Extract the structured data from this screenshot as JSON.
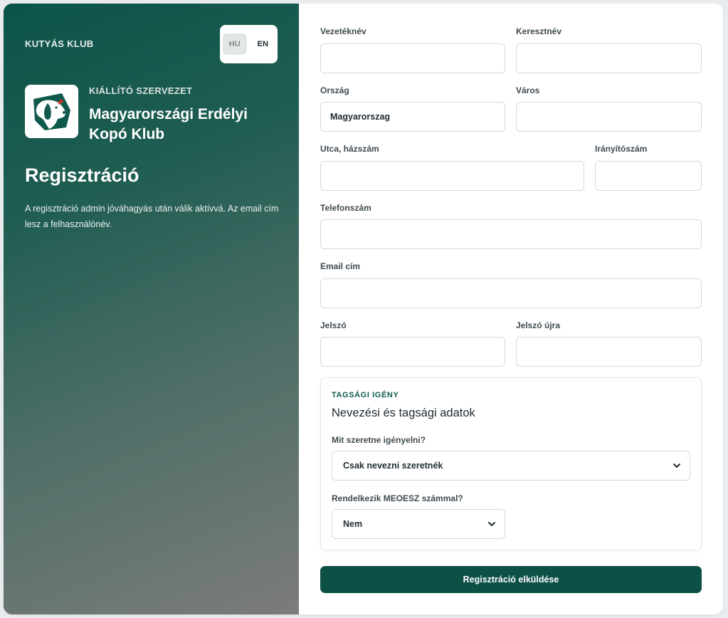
{
  "brand": "KUTYÁS KLUB",
  "language": {
    "hu": "HU",
    "en": "EN",
    "selected": "HU"
  },
  "organization": {
    "label": "KIÁLLÍTÓ SZERVEZET",
    "name": "Magyarországi Erdélyi Kopó Klub"
  },
  "page": {
    "title": "Regisztráció",
    "description": "A regisztráció admin jóváhagyás után válik aktívvá. Az email cím lesz a felhasználónév."
  },
  "form": {
    "last_name": {
      "label": "Vezetéknév",
      "value": ""
    },
    "first_name": {
      "label": "Keresztnév",
      "value": ""
    },
    "country": {
      "label": "Ország",
      "value": "Magyarorszag"
    },
    "city": {
      "label": "Város",
      "value": ""
    },
    "street": {
      "label": "Utca, házszám",
      "value": ""
    },
    "zip": {
      "label": "Irányítószám",
      "value": ""
    },
    "phone": {
      "label": "Telefonszám",
      "value": ""
    },
    "email": {
      "label": "Email cím",
      "value": ""
    },
    "password": {
      "label": "Jelszó",
      "value": ""
    },
    "password_again": {
      "label": "Jelszó újra",
      "value": ""
    }
  },
  "membership": {
    "section_label": "TAGSÁGI IGÉNY",
    "title": "Nevezési és tagsági adatok",
    "request": {
      "label": "Mit szeretne igényelni?",
      "selected": "Csak nevezni szeretnék"
    },
    "meoesz": {
      "label": "Rendelkezik MEOESZ számmal?",
      "selected": "Nem"
    }
  },
  "submit_label": "Regisztráció elküldése",
  "colors": {
    "primary": "#0d5146",
    "accent_text": "#0f5a4d"
  }
}
